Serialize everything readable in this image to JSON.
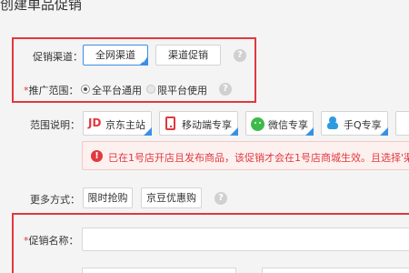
{
  "page": {
    "title": "创建单品促销"
  },
  "channel": {
    "label": "促销渠道：",
    "options": [
      {
        "label": "全网渠道",
        "selected": true
      },
      {
        "label": "渠道促销",
        "selected": false
      }
    ],
    "help": "?"
  },
  "scope": {
    "required": "*",
    "label": "推广范围：",
    "options": [
      {
        "label": "全平台通用",
        "checked": true
      },
      {
        "label": "限平台使用",
        "checked": false
      }
    ],
    "help": "?"
  },
  "scope_desc": {
    "label": "范围说明：",
    "items": [
      {
        "icon": "jd-logo-icon",
        "icon_text": "JD",
        "label": "京东主站"
      },
      {
        "icon": "mobile-phone-icon",
        "label": "移动端专享"
      },
      {
        "icon": "wechat-icon",
        "label": "微信专享"
      },
      {
        "icon": "qq-icon",
        "label": "手Q专享"
      }
    ]
  },
  "notice": {
    "icon_text": "!",
    "text": "已在1号店开店且发布商品，该促销才会在1号店商城生效。且选择'渠"
  },
  "more": {
    "label": "更多方式：",
    "buttons": [
      {
        "label": "限时抢购"
      },
      {
        "label": "京豆优惠购"
      }
    ],
    "help": "?"
  },
  "promo_name": {
    "required": "*",
    "label": "促销名称："
  },
  "colors": {
    "accent": "#3a8ee6",
    "highlight_border": "#e0393e",
    "notice_bg": "#fdf1f0",
    "notice_text": "#e0393e"
  }
}
